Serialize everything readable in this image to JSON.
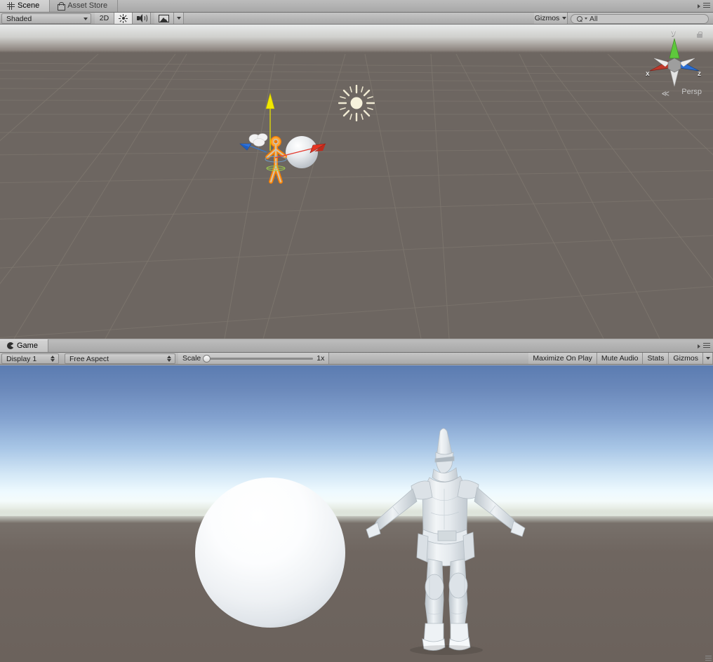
{
  "scene_panel": {
    "tabs": [
      {
        "label": "Scene",
        "icon": "grid-icon",
        "active": true
      },
      {
        "label": "Asset Store",
        "icon": "shopping-bag-icon",
        "active": false
      }
    ],
    "menu_icon": "panel-options-icon",
    "toolbar": {
      "draw_mode": "Shaded",
      "view_mode_2d": "2D",
      "lighting_icon": "sun-icon",
      "audio_icon": "speaker-icon",
      "effects_icon": "image-icon",
      "effects_caret": "chevron-down-icon",
      "gizmos_label": "Gizmos",
      "gizmos_caret": "chevron-down-icon",
      "search_placeholder": "All",
      "search_value": "All",
      "search_icon": "magnifier-icon"
    },
    "viewport": {
      "gizmo": {
        "axis_x": "x",
        "axis_y": "y",
        "axis_z": "z",
        "projection": "Persp",
        "projection_arrow": "≪",
        "lock_icon": "lock-icon",
        "color_x": "#c0392b",
        "color_y": "#5ec83c",
        "color_z": "#2b6fd4",
        "color_neutral": "#e4e4e4",
        "color_hub": "#9e9e9e"
      },
      "background_color": "#6d6661",
      "grid_color": "#7d766f",
      "selection_outline_color": "#ff8000",
      "objects": [
        {
          "name": "character-gizmo",
          "type": "selected-humanoid"
        },
        {
          "name": "sphere-gizmo",
          "type": "sphere"
        },
        {
          "name": "camera-gizmo",
          "type": "camera-icon"
        },
        {
          "name": "directional-light-gizmo",
          "type": "sun-icon"
        },
        {
          "name": "move-tool-handle-y",
          "type": "axis-arrow",
          "color": "#ffe800"
        },
        {
          "name": "move-tool-handle-x",
          "type": "axis-arrow",
          "color": "#ea3323"
        },
        {
          "name": "move-tool-handle-z",
          "type": "axis-arrow",
          "color": "#2f7bdd"
        }
      ]
    }
  },
  "game_panel": {
    "tabs": [
      {
        "label": "Game",
        "icon": "game-icon",
        "active": true
      }
    ],
    "menu_icon": "panel-options-icon",
    "toolbar": {
      "display": "Display 1",
      "aspect": "Free Aspect",
      "scale_label": "Scale",
      "scale_value": "1x",
      "scale_percent": 0,
      "maximize_on_play": "Maximize On Play",
      "mute_audio": "Mute Audio",
      "stats": "Stats",
      "gizmos_label": "Gizmos",
      "gizmos_caret": "chevron-down-icon"
    },
    "viewport": {
      "sky_top_color": "#5b7cb1",
      "sky_horizon_color": "#eefaff",
      "ground_color": "#6f6660",
      "objects": [
        {
          "name": "sphere",
          "type": "sphere",
          "color": "#ffffff"
        },
        {
          "name": "character",
          "type": "humanoid-t-pose",
          "color": "#e9eef2"
        }
      ]
    }
  }
}
